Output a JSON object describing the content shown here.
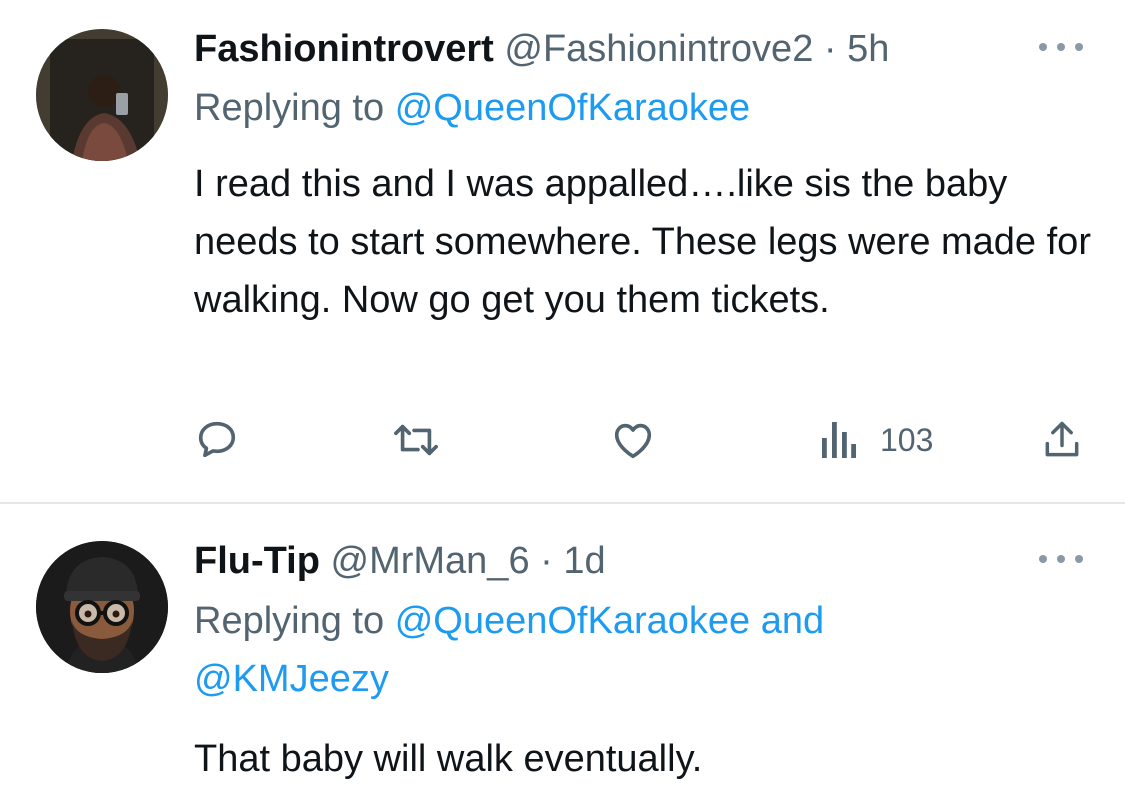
{
  "tweets": [
    {
      "author": {
        "display_name": "Fashionintrovert",
        "handle": "@Fashionintrove2",
        "time": "· 5h"
      },
      "replying_prefix": "Replying to",
      "replying_to": "@QueenOfKaraokee",
      "text": "I read this and I was appalled….like sis the baby needs to start somewhere. These legs were made for walking. Now go get you them tickets.",
      "actions": {
        "views": "103"
      }
    },
    {
      "author": {
        "display_name": "Flu-Tip",
        "handle": "@MrMan_6",
        "time": "· 1d"
      },
      "replying_prefix": "Replying to",
      "replying_to": "@QueenOfKaraokee",
      "replying_and": "and",
      "replying_to_2": "@KMJeezy",
      "text": "That baby will walk eventually."
    }
  ],
  "colors": {
    "text": "#0f1419",
    "secondary": "#536471",
    "link": "#1d9bf0",
    "divider": "#e4e7ea"
  },
  "icons": [
    "reply-icon",
    "retweet-icon",
    "like-icon",
    "views-icon",
    "share-icon",
    "more-icon"
  ]
}
